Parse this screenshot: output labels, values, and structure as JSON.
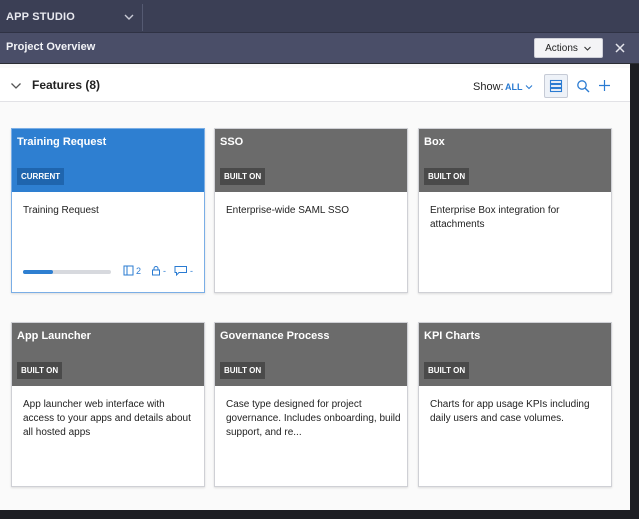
{
  "topbar": {
    "app_name": "APP STUDIO"
  },
  "subbar": {
    "title": "Project Overview",
    "actions_label": "Actions"
  },
  "features": {
    "title": "Features (8)",
    "show_label": "Show:",
    "show_value": "ALL"
  },
  "cards": [
    {
      "title": "Training Request",
      "badge": "CURRENT",
      "description": "Training Request",
      "current": true,
      "progress": 0.34,
      "meta": {
        "docs": "2",
        "lock": "-",
        "chat": "-"
      }
    },
    {
      "title": "SSO",
      "badge": "BUILT ON",
      "description": "Enterprise-wide SAML SSO"
    },
    {
      "title": "Box",
      "badge": "BUILT ON",
      "description": "Enterprise Box integration for attachments"
    },
    {
      "title": "App Launcher",
      "badge": "BUILT ON",
      "description": "App launcher web interface with access to your apps and details about all hosted apps"
    },
    {
      "title": "Governance Process",
      "badge": "BUILT ON",
      "description": "Case type designed for project governance. Includes onboarding, build support, and re..."
    },
    {
      "title": "KPI Charts",
      "badge": "BUILT ON",
      "description": "Charts for app usage KPIs including daily users and case volumes."
    }
  ],
  "colors": {
    "accent": "#2e7fd1",
    "card_header": "#6b6b6b",
    "topbar": "#3b3f55",
    "subbar": "#4a4e68"
  }
}
